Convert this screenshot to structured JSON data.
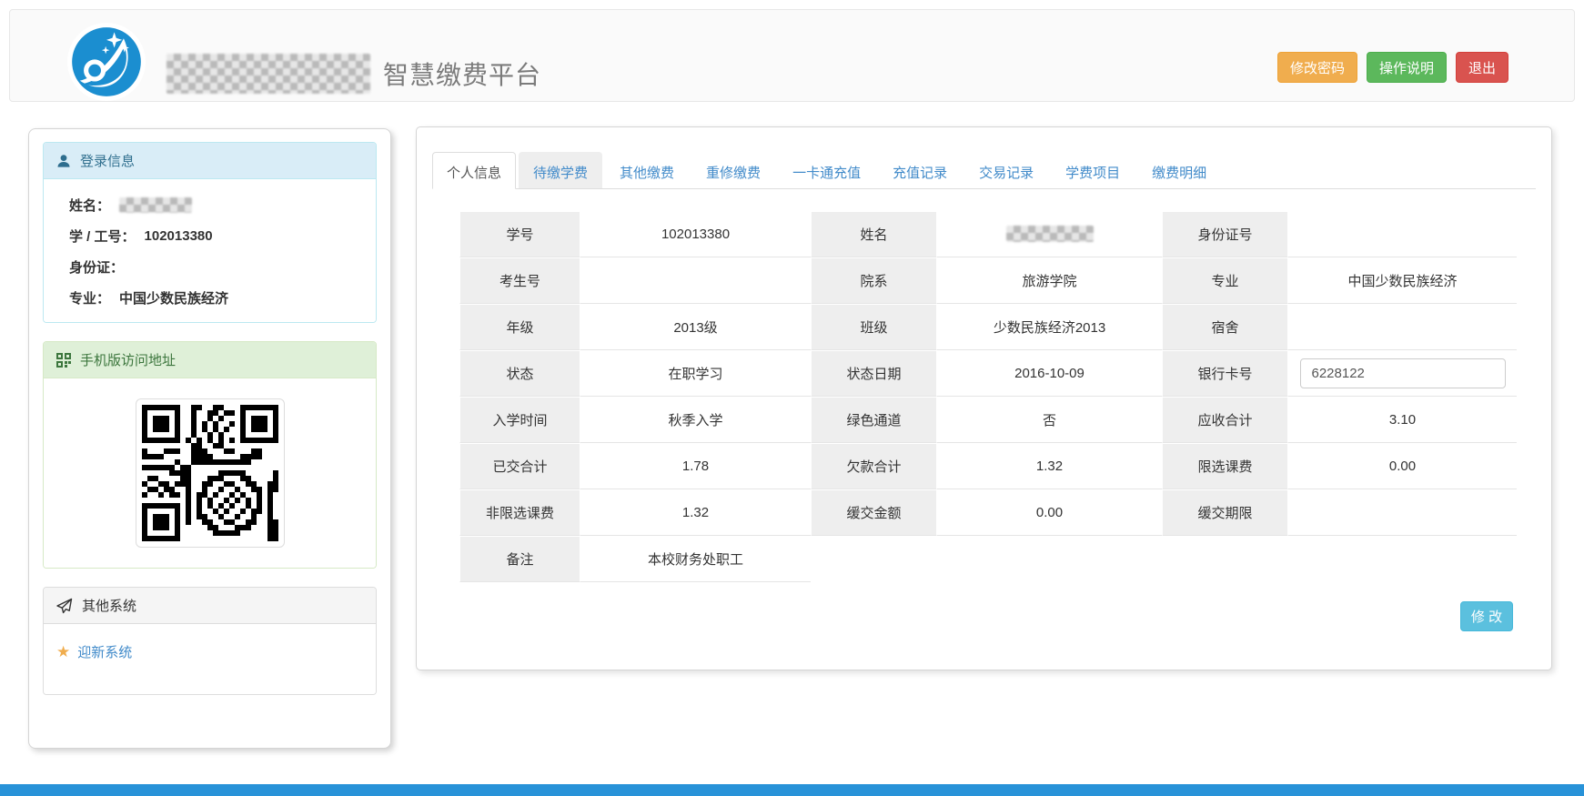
{
  "header": {
    "platform_title": "智慧缴费平台",
    "school_name_redacted": true,
    "buttons": {
      "change_password": "修改密码",
      "instructions": "操作说明",
      "logout": "退出"
    }
  },
  "sidebar": {
    "login_panel": {
      "title": "登录信息",
      "fields": [
        {
          "label": "姓名：",
          "value": "",
          "masked": true
        },
        {
          "label": "学 / 工号：",
          "value": "102013380"
        },
        {
          "label": "身份证：",
          "value": ""
        },
        {
          "label": "专业：",
          "value": "中国少数民族经济"
        }
      ]
    },
    "qr_panel": {
      "title": "手机版访问地址"
    },
    "other_panel": {
      "title": "其他系统",
      "links": [
        {
          "label": "迎新系统"
        }
      ]
    }
  },
  "main": {
    "tabs": [
      {
        "label": "个人信息",
        "active": true
      },
      {
        "label": "待缴学费"
      },
      {
        "label": "其他缴费"
      },
      {
        "label": "重修缴费"
      },
      {
        "label": "一卡通充值"
      },
      {
        "label": "充值记录"
      },
      {
        "label": "交易记录"
      },
      {
        "label": "学费项目"
      },
      {
        "label": "缴费明细"
      }
    ],
    "table": {
      "rows": [
        {
          "cells": [
            {
              "label": "学号",
              "value": "102013380"
            },
            {
              "label": "姓名",
              "value": "",
              "masked": true
            },
            {
              "label": "身份证号",
              "value": ""
            }
          ]
        },
        {
          "cells": [
            {
              "label": "考生号",
              "value": ""
            },
            {
              "label": "院系",
              "value": "旅游学院"
            },
            {
              "label": "专业",
              "value": "中国少数民族经济"
            }
          ]
        },
        {
          "cells": [
            {
              "label": "年级",
              "value": "2013级"
            },
            {
              "label": "班级",
              "value": "少数民族经济2013"
            },
            {
              "label": "宿舍",
              "value": ""
            }
          ]
        },
        {
          "cells": [
            {
              "label": "状态",
              "value": "在职学习"
            },
            {
              "label": "状态日期",
              "value": "2016-10-09"
            },
            {
              "label": "银行卡号",
              "value": "6228122",
              "input": true
            }
          ]
        },
        {
          "cells": [
            {
              "label": "入学时间",
              "value": "秋季入学"
            },
            {
              "label": "绿色通道",
              "value": "否"
            },
            {
              "label": "应收合计",
              "value": "3.10"
            }
          ]
        },
        {
          "cells": [
            {
              "label": "已交合计",
              "value": "1.78"
            },
            {
              "label": "欠款合计",
              "value": "1.32"
            },
            {
              "label": "限选课费",
              "value": "0.00"
            }
          ]
        },
        {
          "cells": [
            {
              "label": "非限选课费",
              "value": "1.32"
            },
            {
              "label": "缓交金额",
              "value": "0.00"
            },
            {
              "label": "缓交期限",
              "value": ""
            }
          ]
        },
        {
          "cells": [
            {
              "label": "备注",
              "value": "本校财务处职工"
            }
          ]
        }
      ]
    },
    "edit_button": "修 改"
  },
  "colors": {
    "footer_bar": "#2892d8",
    "logo_blue": "#1b8ed0",
    "link_blue": "#428bca",
    "btn_orange": "#f0ad4e",
    "btn_green": "#5cb85c",
    "btn_red": "#d9534f",
    "btn_edit_blue": "#5bc0de",
    "panel_info_bg": "#d9edf7",
    "panel_success_bg": "#dff0d8",
    "panel_default_bg": "#f5f5f5",
    "table_label_bg": "#eeeeee"
  }
}
